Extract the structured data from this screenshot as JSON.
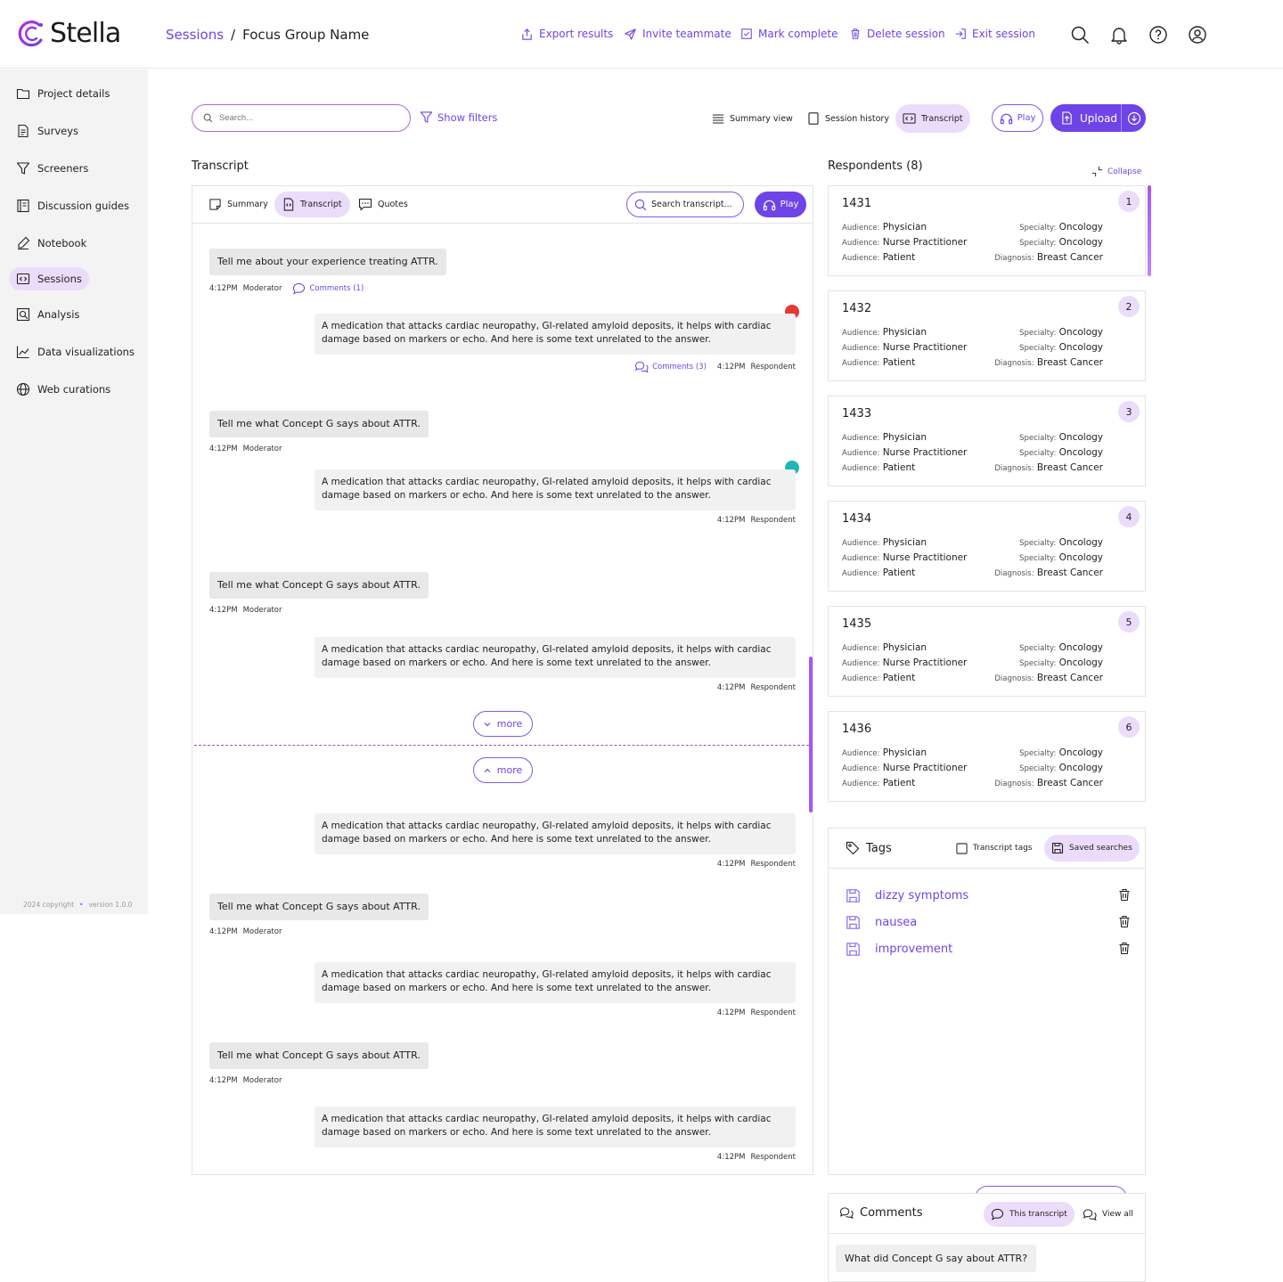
{
  "app": {
    "name": "Stella"
  },
  "breadcrumb": {
    "root": "Sessions",
    "separator": "/",
    "current": "Focus Group Name"
  },
  "header_actions": [
    {
      "label": "Export results",
      "icon": "export-icon"
    },
    {
      "label": "Invite teammate",
      "icon": "send-icon"
    },
    {
      "label": "Mark complete",
      "icon": "check-square-icon"
    },
    {
      "label": "Delete session",
      "icon": "trash-icon"
    },
    {
      "label": "Exit session",
      "icon": "exit-icon"
    }
  ],
  "header_icons": [
    "search-icon",
    "bell-icon",
    "help-icon",
    "user-icon"
  ],
  "sidebar": {
    "items": [
      {
        "label": "Project details",
        "icon": "folder-icon"
      },
      {
        "label": "Surveys",
        "icon": "document-icon"
      },
      {
        "label": "Screeners",
        "icon": "filter-icon"
      },
      {
        "label": "Discussion guides",
        "icon": "guide-icon"
      },
      {
        "label": "Notebook",
        "icon": "pen-icon"
      },
      {
        "label": "Sessions",
        "icon": "sessions-icon",
        "active": true
      },
      {
        "label": "Analysis",
        "icon": "analysis-icon"
      },
      {
        "label": "Data visualizations",
        "icon": "chart-icon"
      },
      {
        "label": "Web curations",
        "icon": "globe-icon"
      }
    ],
    "copyright": "2024 copyright",
    "version": "version 1.0.0"
  },
  "toolbar": {
    "search_placeholder": "Search...",
    "show_filters": "Show filters",
    "view_tabs": [
      {
        "label": "Summary view",
        "icon": "list-icon"
      },
      {
        "label": "Session history",
        "icon": "tablet-icon"
      },
      {
        "label": "Transcript",
        "icon": "transcript-icon",
        "active": true
      }
    ],
    "play_label": "Play",
    "upload_label": "Upload"
  },
  "transcript": {
    "title": "Transcript",
    "tabs": [
      {
        "label": "Summary",
        "icon": "note-icon"
      },
      {
        "label": "Transcript",
        "icon": "transcript-icon",
        "active": true
      },
      {
        "label": "Quotes",
        "icon": "quote-icon"
      }
    ],
    "search_placeholder": "Search transcript...",
    "play_label": "Play",
    "more_label": "more",
    "messages": [
      {
        "role": "q",
        "text": "Tell me about your experience treating ATTR.",
        "time": "4:12PM",
        "speaker": "Moderator",
        "comments": "Comments (1)"
      },
      {
        "role": "a",
        "text": "A medication that attacks cardiac neuropathy, GI-related amyloid deposits, it helps with cardiac damage based on markers or echo. And here is some text unrelated to the answer.",
        "time": "4:12PM",
        "speaker": "Respondent",
        "comments": "Comments (3)",
        "dot": "#e53935"
      },
      {
        "role": "q",
        "text": "Tell me what Concept G says about ATTR.",
        "time": "4:12PM",
        "speaker": "Moderator"
      },
      {
        "role": "a",
        "text": "A medication that attacks cardiac neuropathy, GI-related amyloid deposits, it helps with cardiac damage based on markers or echo. And here is some text unrelated to the answer.",
        "time": "4:12PM",
        "speaker": "Respondent",
        "dot": "#22b5b5"
      },
      {
        "role": "q",
        "text": "Tell me what Concept G says about ATTR.",
        "time": "4:12PM",
        "speaker": "Moderator"
      },
      {
        "role": "a",
        "text": "A medication that attacks cardiac neuropathy, GI-related amyloid deposits, it helps with cardiac damage based on markers or echo. And here is some text unrelated to the answer.",
        "time": "4:12PM",
        "speaker": "Respondent"
      },
      {
        "role": "a",
        "text": "A medication that attacks cardiac neuropathy, GI-related amyloid deposits, it helps with cardiac damage based on markers or echo. And here is some text unrelated to the answer.",
        "time": "4:12PM",
        "speaker": "Respondent"
      },
      {
        "role": "q",
        "text": "Tell me what Concept G says about ATTR.",
        "time": "4:12PM",
        "speaker": "Moderator"
      },
      {
        "role": "a",
        "text": "A medication that attacks cardiac neuropathy, GI-related amyloid deposits, it helps with cardiac damage based on markers or echo. And here is some text unrelated to the answer.",
        "time": "4:12PM",
        "speaker": "Respondent"
      },
      {
        "role": "q",
        "text": "Tell me what Concept G says about ATTR.",
        "time": "4:12PM",
        "speaker": "Moderator"
      },
      {
        "role": "a",
        "text": "A medication that attacks cardiac neuropathy, GI-related amyloid deposits, it helps with cardiac damage based on markers or echo. And here is some text unrelated to the answer.",
        "time": "4:12PM",
        "speaker": "Respondent"
      }
    ]
  },
  "respondents": {
    "title": "Respondents (8)",
    "collapse_label": "Collapse",
    "cards": [
      {
        "id": "1431",
        "badge": "1",
        "rows": [
          [
            "Audience:",
            "Physician",
            "Specialty:",
            "Oncology"
          ],
          [
            "Audience:",
            "Nurse Practitioner",
            "Specialty:",
            "Oncology"
          ],
          [
            "Audience:",
            "Patient",
            "Diagnosis:",
            "Breast Cancer"
          ]
        ]
      },
      {
        "id": "1432",
        "badge": "2",
        "rows": [
          [
            "Audience:",
            "Physician",
            "Specialty:",
            "Oncology"
          ],
          [
            "Audience:",
            "Nurse Practitioner",
            "Specialty:",
            "Oncology"
          ],
          [
            "Audience:",
            "Patient",
            "Diagnosis:",
            "Breast Cancer"
          ]
        ]
      },
      {
        "id": "1433",
        "badge": "3",
        "rows": [
          [
            "Audience:",
            "Physician",
            "Specialty:",
            "Oncology"
          ],
          [
            "Audience:",
            "Nurse Practitioner",
            "Specialty:",
            "Oncology"
          ],
          [
            "Audience:",
            "Patient",
            "Diagnosis:",
            "Breast Cancer"
          ]
        ]
      },
      {
        "id": "1434",
        "badge": "4",
        "rows": [
          [
            "Audience:",
            "Physician",
            "Specialty:",
            "Oncology"
          ],
          [
            "Audience:",
            "Nurse Practitioner",
            "Specialty:",
            "Oncology"
          ],
          [
            "Audience:",
            "Patient",
            "Diagnosis:",
            "Breast Cancer"
          ]
        ]
      },
      {
        "id": "1435",
        "badge": "5",
        "rows": [
          [
            "Audience:",
            "Physician",
            "Specialty:",
            "Oncology"
          ],
          [
            "Audience:",
            "Nurse Practitioner",
            "Specialty:",
            "Oncology"
          ],
          [
            "Audience:",
            "Patient",
            "Diagnosis:",
            "Breast Cancer"
          ]
        ]
      },
      {
        "id": "1436",
        "badge": "6",
        "rows": [
          [
            "Audience:",
            "Physician",
            "Specialty:",
            "Oncology"
          ],
          [
            "Audience:",
            "Nurse Practitioner",
            "Specialty:",
            "Oncology"
          ],
          [
            "Audience:",
            "Patient",
            "Diagnosis:",
            "Breast Cancer"
          ]
        ]
      }
    ]
  },
  "tags": {
    "title": "Tags",
    "tabs": [
      {
        "label": "Transcript tags",
        "icon": "tablet-icon"
      },
      {
        "label": "Saved searches",
        "icon": "save-icon",
        "active": true
      }
    ],
    "saved_searches": [
      "dizzy symptoms",
      "nausea",
      "improvement"
    ]
  },
  "comments": {
    "title": "Comments",
    "tabs": [
      {
        "label": "This transcript",
        "icon": "comment-icon",
        "active": true
      },
      {
        "label": "View all",
        "icon": "comments-icon"
      }
    ],
    "items": [
      "What did Concept G say about ATTR?"
    ]
  },
  "colors": {
    "accent": "#6e44e8",
    "active_bg": "#ecdcfb",
    "bubble_q": "#e8e8e8",
    "bubble_a": "#f1f1f1"
  }
}
